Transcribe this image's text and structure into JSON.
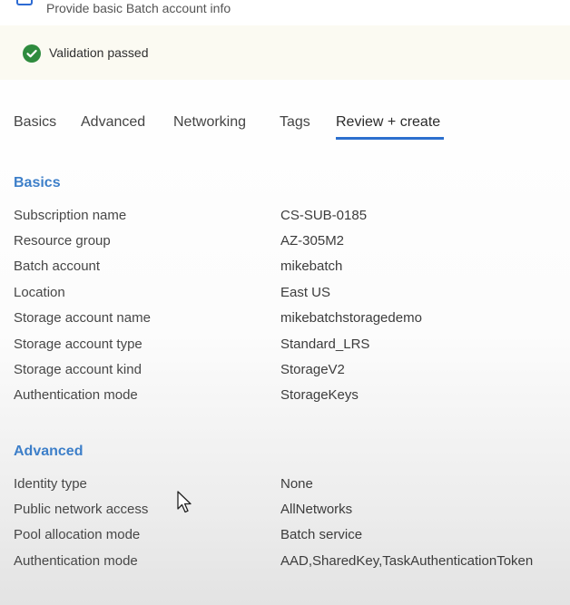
{
  "header": {
    "subtitle": "Provide basic Batch account info",
    "icon": "batch-icon"
  },
  "validation": {
    "icon": "check-circle-icon",
    "text": "Validation passed",
    "color": "#2e8b3e"
  },
  "tabs": [
    {
      "label": "Basics"
    },
    {
      "label": "Advanced"
    },
    {
      "label": "Networking"
    },
    {
      "label": "Tags"
    },
    {
      "label": "Review + create",
      "active": true
    }
  ],
  "basics": {
    "title": "Basics",
    "rows": [
      {
        "label": "Subscription name",
        "value": "CS-SUB-0185"
      },
      {
        "label": "Resource group",
        "value": "AZ-305M2"
      },
      {
        "label": "Batch account",
        "value": "mikebatch"
      },
      {
        "label": "Location",
        "value": "East US"
      },
      {
        "label": "Storage account name",
        "value": "mikebatchstoragedemo"
      },
      {
        "label": "Storage account type",
        "value": "Standard_LRS"
      },
      {
        "label": "Storage account kind",
        "value": "StorageV2"
      },
      {
        "label": "Authentication mode",
        "value": "StorageKeys"
      }
    ]
  },
  "advanced": {
    "title": "Advanced",
    "rows": [
      {
        "label": "Identity type",
        "value": "None"
      },
      {
        "label": "Public network access",
        "value": "AllNetworks"
      },
      {
        "label": "Pool allocation mode",
        "value": "Batch service"
      },
      {
        "label": "Authentication mode",
        "value": "AAD,SharedKey,TaskAuthenticationToken"
      }
    ]
  },
  "colors": {
    "accent": "#2c6fce",
    "section_title": "#3d7fc9",
    "banner_bg": "#fbfaf2"
  }
}
